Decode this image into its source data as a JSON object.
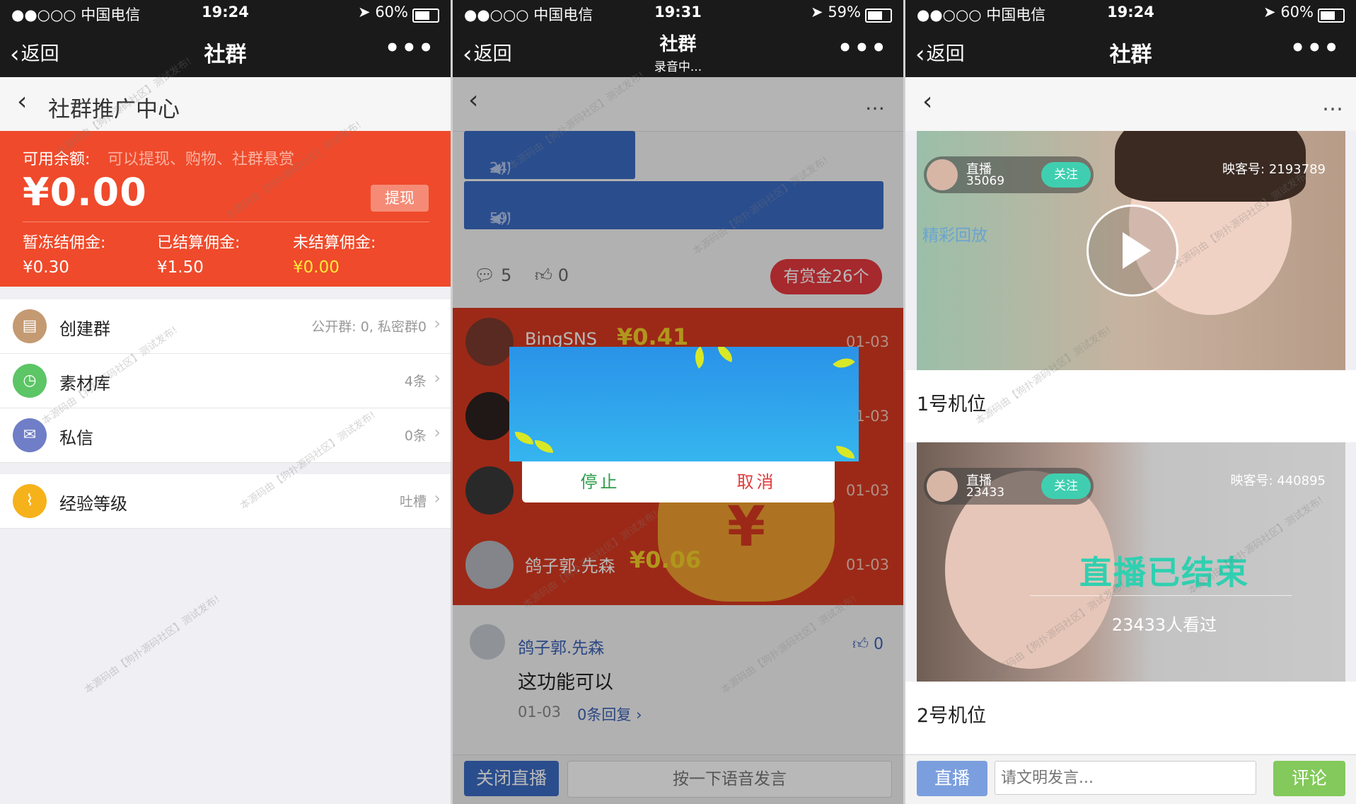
{
  "status_bars": [
    {
      "carrier": "●●○○○ 中国电信",
      "time": "19:24",
      "battery": "60%",
      "battery_level": 0.6
    },
    {
      "carrier": "●●○○○ 中国电信",
      "time": "19:31",
      "battery": "59%",
      "battery_level": 0.59
    },
    {
      "carrier": "●●○○○ 中国电信",
      "time": "19:24",
      "battery": "60%",
      "battery_level": 0.6
    }
  ],
  "navbars": [
    {
      "back": "返回",
      "title": "社群",
      "more": "•••"
    },
    {
      "back": "返回",
      "title": "社群",
      "subtitle": "录音中...",
      "more": "•••"
    },
    {
      "back": "返回",
      "title": "社群",
      "more": "•••"
    }
  ],
  "promo": {
    "title": "社群推广中心",
    "balance_label": "可用余额:",
    "balance_hint": "可以提现、购物、社群悬赏",
    "balance": "¥0.00",
    "withdraw": "提现",
    "commissions": [
      {
        "label": "暂冻结佣金:",
        "value": "¥0.30"
      },
      {
        "label": "已结算佣金:",
        "value": "¥1.50"
      },
      {
        "label": "未结算佣金:",
        "value": "¥0.00"
      }
    ],
    "menu": [
      {
        "label": "创建群",
        "meta": "公开群: 0, 私密群0",
        "icon": "chat-icon"
      },
      {
        "label": "素材库",
        "meta": "4条",
        "icon": "clock-icon"
      },
      {
        "label": "私信",
        "meta": "0条",
        "icon": "mail-icon"
      }
    ],
    "level": {
      "label": "经验等级",
      "meta": "吐槽",
      "icon": "chart-icon"
    }
  },
  "chat": {
    "voices": [
      {
        "duration": "24'"
      },
      {
        "duration": "59'"
      }
    ],
    "comments_count": "5",
    "likes_count": "0",
    "reward": "有赏金26个",
    "rewards": [
      {
        "name": "BingSNS",
        "amount": "¥0.41",
        "date": "01-03"
      },
      {
        "name": "",
        "amount": "",
        "date": "01-03"
      },
      {
        "name": "",
        "amount": "",
        "date": "01-03"
      },
      {
        "name": "鸽子郭.先森",
        "amount": "¥0.06",
        "date": "01-03"
      }
    ],
    "bag_symbol": "¥",
    "comment": {
      "name": "鸽子郭.先森",
      "text": "这功能可以",
      "date": "01-03",
      "replies": "0条回复",
      "likes": "0"
    },
    "close_live": "关闭直播",
    "hold_voice": "按一下语音发言",
    "dialog": {
      "stop": "停止",
      "cancel": "取消"
    }
  },
  "live": {
    "cards": [
      {
        "anchor_label": "直播",
        "anchor_id": "35069",
        "follow": "关注",
        "viewers_label": "映客号:",
        "viewers": "2193789",
        "replay": "精彩回放",
        "slot": "1号机位"
      },
      {
        "anchor_label": "直播",
        "anchor_id": "23433",
        "follow": "关注",
        "viewers_label": "映客号:",
        "viewers": "440895",
        "ended": "直播已结束",
        "watched": "23433人看过",
        "slot": "2号机位"
      }
    ],
    "live_button": "直播",
    "input_placeholder": "请文明发言...",
    "comment_button": "评论"
  },
  "watermark": "本源码由【狗扑源码社区】测试发布!",
  "colors": {
    "wallet_red": "#ef4a2b",
    "live_blue": "#3b6bc4",
    "reward_red": "#e6393f",
    "follow_teal": "#3fcfb0",
    "ended_teal": "#2fd0b0",
    "comment_green": "#83c95b"
  }
}
